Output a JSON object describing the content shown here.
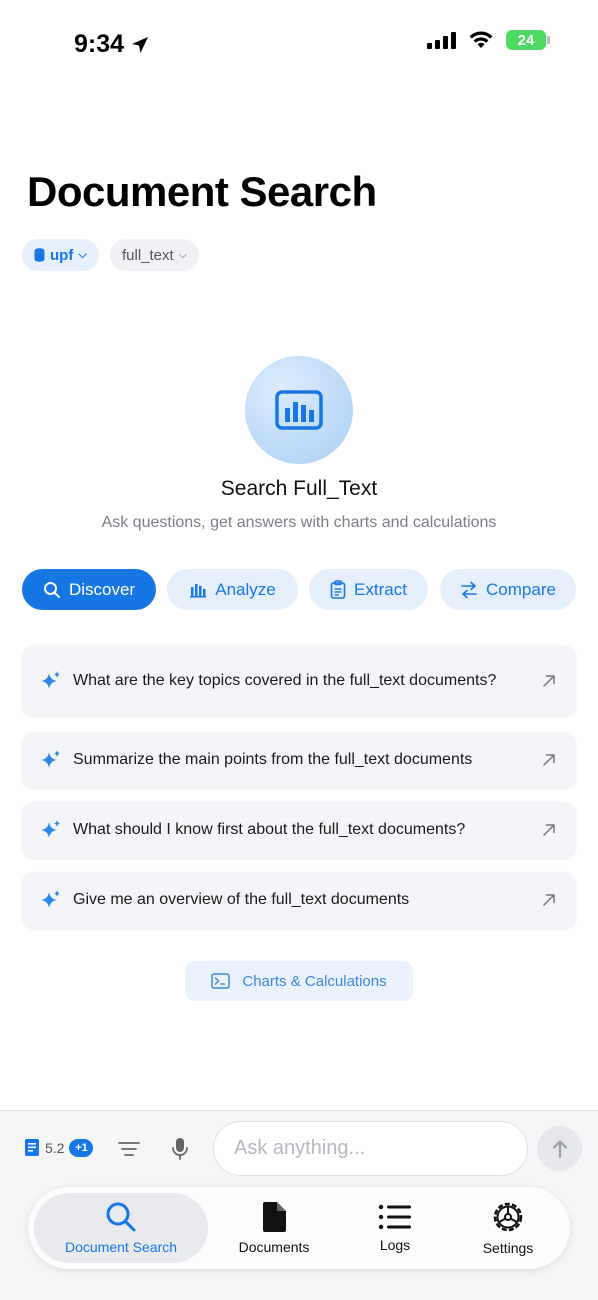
{
  "status_bar": {
    "time": "9:34",
    "battery": "24"
  },
  "page": {
    "title": "Document Search"
  },
  "filters": {
    "database": "upf",
    "collection": "full_text"
  },
  "hero": {
    "title": "Search Full_Text",
    "subtitle": "Ask questions, get answers with charts and calculations"
  },
  "modes": [
    {
      "label": "Discover",
      "icon": "search-icon",
      "active": true
    },
    {
      "label": "Analyze",
      "icon": "bar-chart-icon",
      "active": false
    },
    {
      "label": "Extract",
      "icon": "clipboard-icon",
      "active": false
    },
    {
      "label": "Compare",
      "icon": "swap-arrows-icon",
      "active": false
    }
  ],
  "suggestions": [
    "What are the key topics covered in the full_text documents?",
    "Summarize the main points from the full_text documents",
    "What should I know first about the full_text documents?",
    "Give me an overview of the full_text documents"
  ],
  "charts_button": {
    "label": "Charts & Calculations"
  },
  "composer": {
    "model_version": "5.2",
    "attachment_count": "+1",
    "placeholder": "Ask anything..."
  },
  "tabs": [
    {
      "label": "Document Search",
      "icon": "search-icon",
      "active": true
    },
    {
      "label": "Documents",
      "icon": "document-icon",
      "active": false
    },
    {
      "label": "Logs",
      "icon": "list-icon",
      "active": false
    },
    {
      "label": "Settings",
      "icon": "gear-icon",
      "active": false
    }
  ],
  "colors": {
    "accent": "#1677e4",
    "accent_light": "#e4effb",
    "battery": "#4cd964"
  }
}
